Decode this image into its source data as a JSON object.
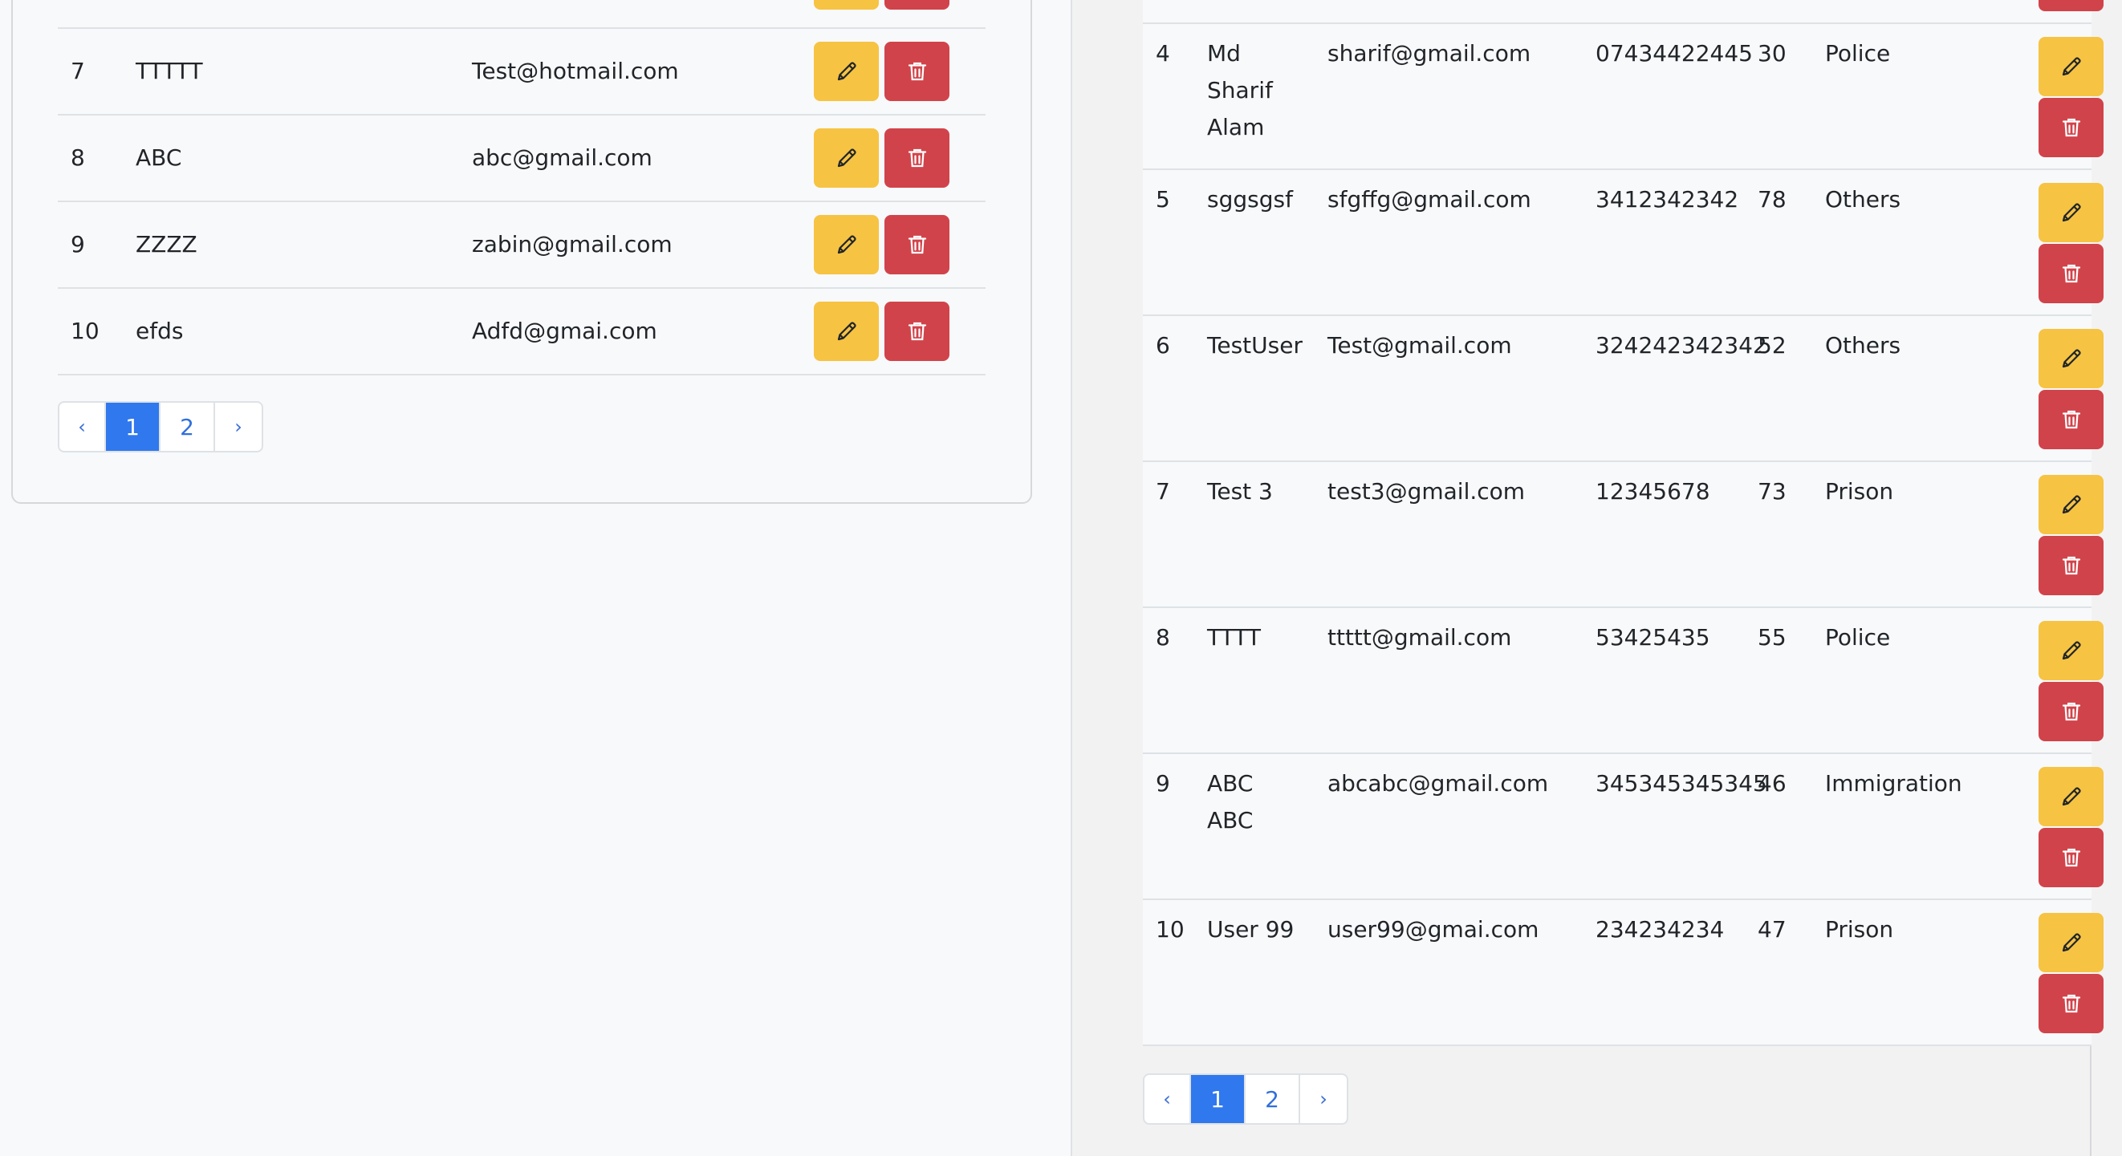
{
  "left_table": {
    "rows": [
      {
        "id": "7",
        "name": "TTTTT",
        "email": "Test@hotmail.com"
      },
      {
        "id": "8",
        "name": "ABC",
        "email": "abc@gmail.com"
      },
      {
        "id": "9",
        "name": "ZZZZ",
        "email": "zabin@gmail.com"
      },
      {
        "id": "10",
        "name": "efds",
        "email": "Adfd@gmai.com"
      }
    ],
    "pagination": {
      "prev": "‹",
      "pages": [
        "1",
        "2"
      ],
      "active": "1",
      "next": "›"
    }
  },
  "right_table": {
    "rows": [
      {
        "id": "4",
        "name": "Md Sharif Alam",
        "email": "sharif@gmail.com",
        "phone": "07434422445",
        "age": "30",
        "department": "Police"
      },
      {
        "id": "5",
        "name": "sggsgsf",
        "email": "sfgffg@gmail.com",
        "phone": "3412342342",
        "age": "78",
        "department": "Others"
      },
      {
        "id": "6",
        "name": "TestUser",
        "email": "Test@gmail.com",
        "phone": "324242342342",
        "age": "52",
        "department": "Others"
      },
      {
        "id": "7",
        "name": "Test 3",
        "email": "test3@gmail.com",
        "phone": "12345678",
        "age": "73",
        "department": "Prison"
      },
      {
        "id": "8",
        "name": "TTTT",
        "email": "ttttt@gmail.com",
        "phone": "53425435",
        "age": "55",
        "department": "Police"
      },
      {
        "id": "9",
        "name": "ABC ABC",
        "email": "abcabc@gmail.com",
        "phone": "345345345345",
        "age": "46",
        "department": "Immigration"
      },
      {
        "id": "10",
        "name": "User 99",
        "email": "user99@gmai.com",
        "phone": "234234234",
        "age": "47",
        "department": "Prison"
      }
    ],
    "pagination": {
      "prev": "‹",
      "pages": [
        "1",
        "2"
      ],
      "active": "1",
      "next": "›"
    }
  },
  "icons": {
    "edit": "pencil-icon",
    "delete": "trash-icon"
  },
  "colors": {
    "edit_button": "#f6c343",
    "delete_button": "#d1434a",
    "active_page": "#2f78ee",
    "link": "#2f6fdd"
  }
}
